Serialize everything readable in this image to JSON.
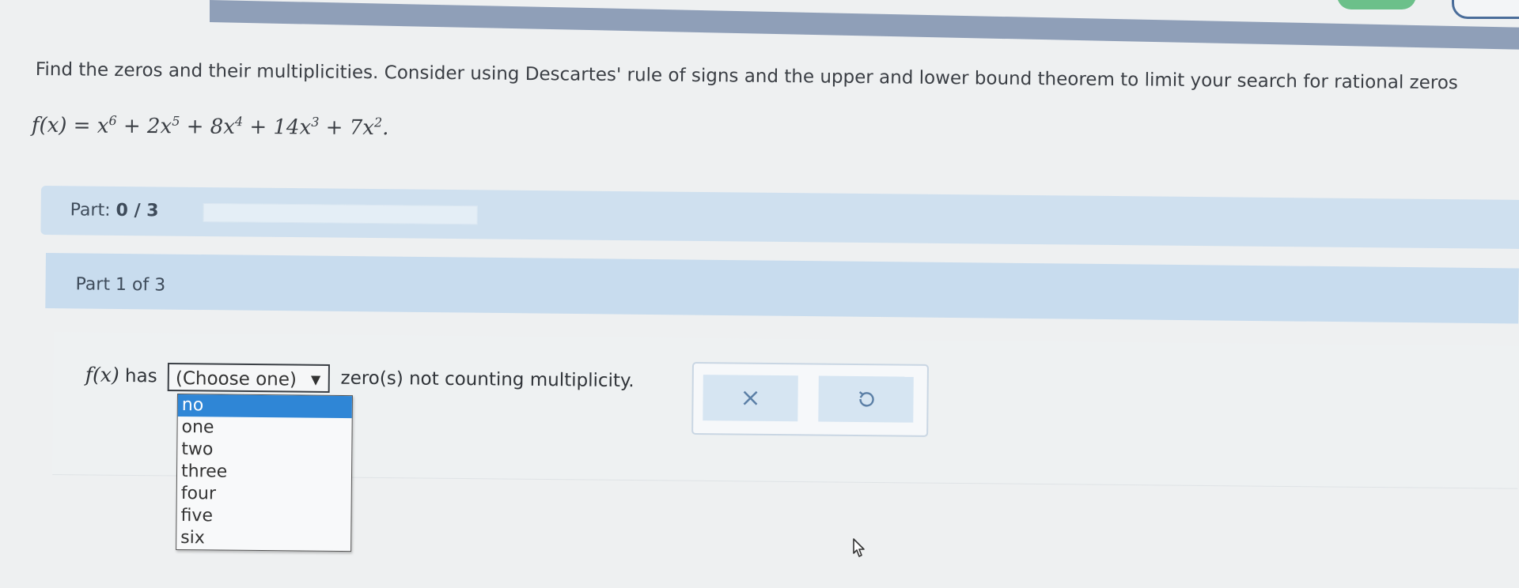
{
  "question": {
    "prompt": "Find the zeros and their multiplicities. Consider using Descartes' rule of signs and the upper and lower bound theorem to limit your search for rational zeros"
  },
  "formula": {
    "fx": "f(x)",
    "eq": " = ",
    "terms": [
      {
        "coef": "",
        "var": "x",
        "exp": "6",
        "sep": " + "
      },
      {
        "coef": "2",
        "var": "x",
        "exp": "5",
        "sep": " + "
      },
      {
        "coef": "8",
        "var": "x",
        "exp": "4",
        "sep": " + "
      },
      {
        "coef": "14",
        "var": "x",
        "exp": "3",
        "sep": " + "
      },
      {
        "coef": "7",
        "var": "x",
        "exp": "2",
        "sep": "."
      }
    ]
  },
  "part_progress": {
    "label": "Part:",
    "value": "0 / 3",
    "fraction": 0
  },
  "section": {
    "title": "Part 1 of 3"
  },
  "answer": {
    "prefix_fx": "f(x)",
    "prefix_text": " has ",
    "select_value": "(Choose one)",
    "suffix": " zero(s) not counting multiplicity."
  },
  "dropdown": {
    "options": [
      "no",
      "one",
      "two",
      "three",
      "four",
      "five",
      "six"
    ],
    "highlighted": "no"
  },
  "actions": {
    "clear_icon": "close-icon",
    "undo_icon": "undo-icon"
  },
  "colors": {
    "accent": "#2f86d6",
    "header_band": "#c8dcee",
    "icon": "#5b7fa6"
  }
}
